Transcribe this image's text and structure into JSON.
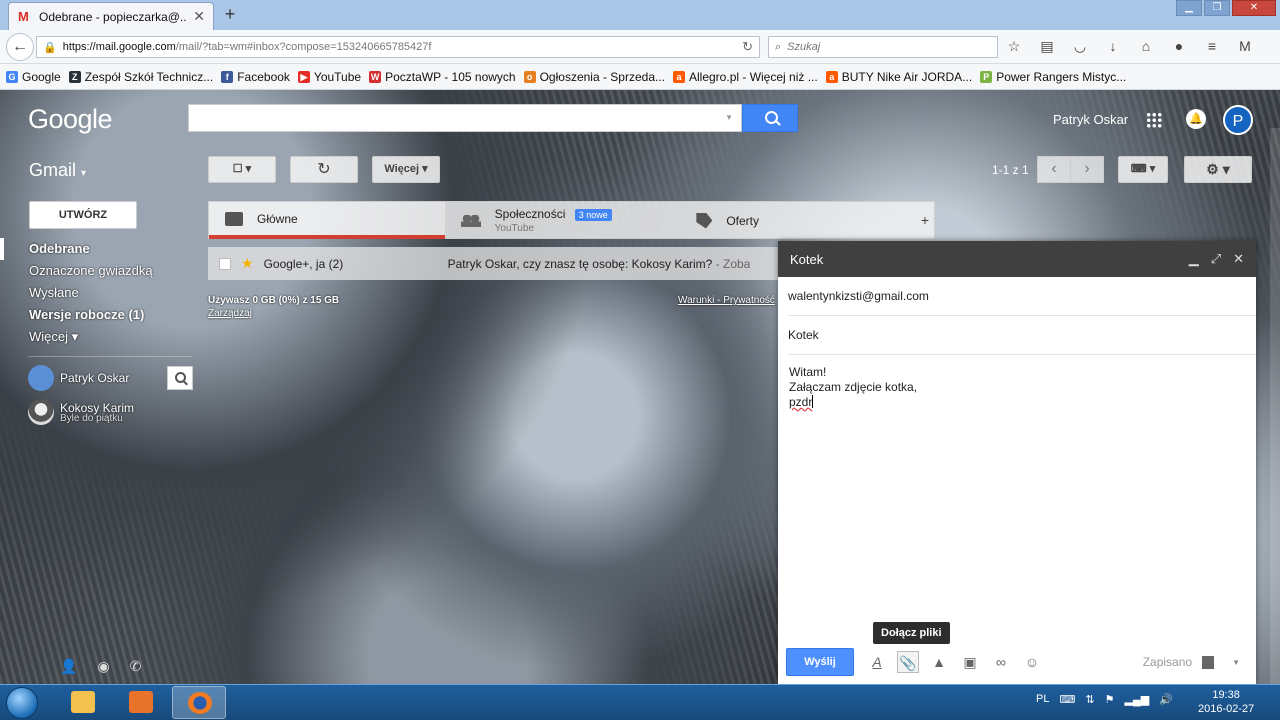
{
  "browser": {
    "tab_title": "Odebrane - popieczarka@...",
    "tab_close": "✕",
    "new_tab": "+",
    "url_host": "https://mail.google.com",
    "url_path": "/mail/?tab=wm#inbox?compose=153240665785427f",
    "search_placeholder": "Szukaj",
    "bookmarks": [
      {
        "label": "Google",
        "color": "#4285f4",
        "icon": "G"
      },
      {
        "label": "Zespół Szkół Technicz...",
        "color": "#263238",
        "icon": "Z"
      },
      {
        "label": "Facebook",
        "color": "#3b5998",
        "icon": "f"
      },
      {
        "label": "YouTube",
        "color": "#e52d27",
        "icon": "▶"
      },
      {
        "label": "PocztaWP - 105 nowych",
        "color": "#d32f2f",
        "icon": "W"
      },
      {
        "label": "Ogłoszenia - Sprzeda...",
        "color": "#e67e22",
        "icon": "o"
      },
      {
        "label": "Allegro.pl - Więcej niż ...",
        "color": "#ff5a00",
        "icon": "a"
      },
      {
        "label": "BUTY Nike Air JORDA...",
        "color": "#ff5a00",
        "icon": "a"
      },
      {
        "label": "Power Rangers Mistyc...",
        "color": "#7cb342",
        "icon": "P"
      }
    ]
  },
  "gmail": {
    "logo": "Google",
    "user_name": "Patryk Oskar",
    "avatar_letter": "P",
    "app_label": "Gmail",
    "toolbar": {
      "more": "Więcej",
      "pager": "1-1 z 1"
    },
    "compose_button": "UTWÓRZ",
    "sidebar": [
      {
        "label": "Odebrane"
      },
      {
        "label": "Oznaczone gwiazdką"
      },
      {
        "label": "Wysłane"
      },
      {
        "label": "Wersje robocze (1)"
      },
      {
        "label": "Więcej ▾"
      }
    ],
    "contacts": [
      {
        "name": "Patryk Oskar",
        "status": ""
      },
      {
        "name": "Kokosy Karim",
        "status": "Byle do piątku"
      }
    ],
    "tabs": [
      {
        "label": "Główne",
        "sub": ""
      },
      {
        "label": "Społeczności",
        "sub": "YouTube",
        "badge": "3 nowe"
      },
      {
        "label": "Oferty",
        "sub": ""
      }
    ],
    "mail": {
      "from": "Google+, ja (2)",
      "subject": "Patryk Oskar, czy znasz tę osobę: Kokosy Karim?",
      "snippet": " - Zoba"
    },
    "storage_text": "Używasz 0 GB (0%) z 15 GB",
    "storage_link": "Zarządzaj",
    "terms": "Warunki - Prywatność"
  },
  "compose": {
    "title": "Kotek",
    "to": "walentynkizsti@gmail.com",
    "subject": "Kotek",
    "body_line1": "Witam!",
    "body_line2": "Załączam zdjęcie kotka,",
    "body_line3": "pzdr",
    "send": "Wyślij",
    "saved": "Zapisano",
    "tooltip": "Dołącz pliki"
  },
  "taskbar": {
    "lang": "PL",
    "time": "19:38",
    "date": "2016-02-27"
  },
  "colors": {
    "accent": "#4285f4",
    "compose_header": "#404040",
    "send": "#4d90fe"
  }
}
